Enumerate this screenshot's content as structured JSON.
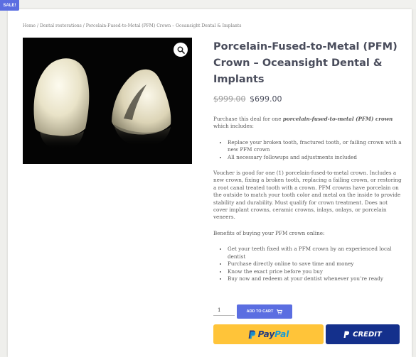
{
  "badge": {
    "label": "SALE!",
    "color": "#5b6ee1"
  },
  "breadcrumb": {
    "home": "Home",
    "sep1": " / ",
    "category": "Dental restorations",
    "sep2": " / ",
    "current": "Porcelain-Fused-to-Metal (PFM) Crown – Oceansight Dental & Implants"
  },
  "product": {
    "image_alt": "Porcelain fused to metal crown photo",
    "zoom_icon": "magnifier-zoom-icon",
    "title": "Porcelain-Fused-to-Metal (PFM) Crown – Oceansight Dental & Implants",
    "price_old": "$999.00",
    "price_new": "$699.00"
  },
  "description": {
    "intro_pre": "Purchase this deal for one ",
    "intro_em": "porcelain-fused-to-metal (PFM) crown",
    "intro_post": " which includes:",
    "includes": [
      "Replace your broken tooth, fractured tooth, or failing crown with a new PFM crown",
      "All necessary followups and adjustments included"
    ],
    "voucher": "Voucher is good for one (1) porcelain-fused-to-metal crown. Includes a new crown, fixing a broken tooth, replacing a failing crown, or restoring a root canal treated tooth with a crown. PFM crowns have porcelain on the outside to match your tooth color and metal on the inside to provide stability and durability. Must qualify for crown treatment. Does not cover implant crowns, ceramic crowns, inlays, onlays, or porcelain veneers.",
    "benefits_heading": "Benefits of buying your PFM crown online:",
    "benefits": [
      "Get your teeth fixed with a PFM crown by an experienced local dentist",
      "Purchase directly online to save time and money",
      "Know the exact price before you buy",
      "Buy now and redeem at your dentist whenever you’re ready"
    ]
  },
  "cart": {
    "quantity": "1",
    "add_label": "ADD TO CART",
    "cart_icon": "cart-icon",
    "accent": "#5b6ee1"
  },
  "payments": {
    "paypal_pay": "Pay",
    "paypal_pal": "Pal",
    "paypal_color": "#ffc439",
    "credit_label": "CREDIT",
    "credit_color": "#14308c"
  }
}
